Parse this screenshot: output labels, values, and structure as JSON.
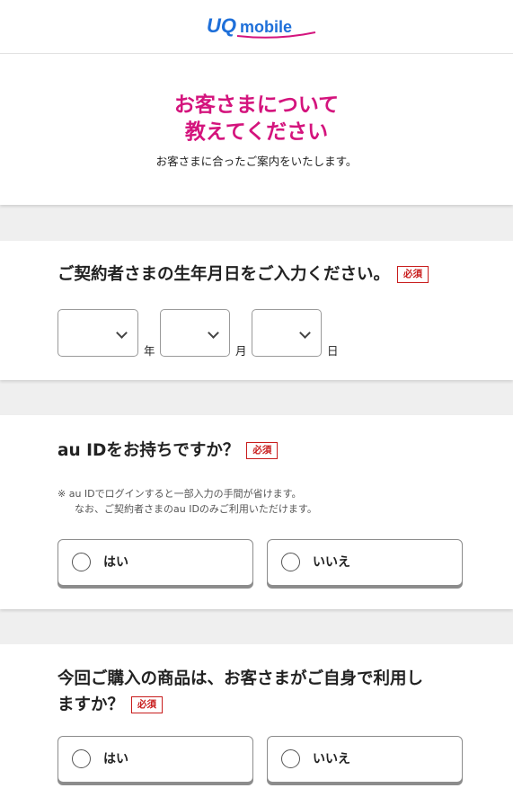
{
  "header": {
    "logo_uq": "UQ",
    "logo_mobile": "mobile"
  },
  "intro": {
    "title_line1": "お客さまについて",
    "title_line2": "教えてください",
    "subtitle": "お客さまに合ったご案内をいたします。"
  },
  "birthdate": {
    "question": "ご契約者さまの生年月日をご入力ください。",
    "required": "必須",
    "year_unit": "年",
    "month_unit": "月",
    "day_unit": "日"
  },
  "auid": {
    "question": "au IDをお持ちですか？",
    "required": "必須",
    "note_line1": "※ au IDでログインすると一部入力の手間が省けます。",
    "note_line2": "なお、ご契約者さまのau IDのみご利用いただけます。",
    "yes": "はい",
    "no": "いいえ"
  },
  "purchase": {
    "question_line1": "今回ご購入の商品は、お客さまがご自身で利用し",
    "question_line2": "ますか？",
    "required": "必須",
    "yes": "はい",
    "no": "いいえ"
  },
  "colors": {
    "accent_pink": "#d4147d",
    "logo_blue": "#1e6fd9",
    "required_red": "#c81c1c"
  }
}
